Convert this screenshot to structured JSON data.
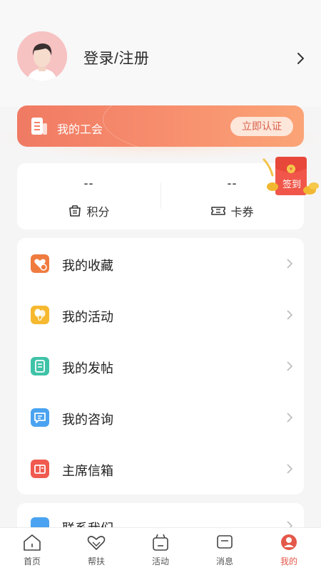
{
  "profile": {
    "login_label": "登录/注册"
  },
  "union": {
    "title": "我的工会",
    "verify_label": "立即认证"
  },
  "points": {
    "points_value": "--",
    "points_label": "积分",
    "coupons_value": "--",
    "coupons_label": "卡券"
  },
  "signin": {
    "label": "签到"
  },
  "menu": {
    "items": [
      {
        "label": "我的收藏",
        "icon": "heart-icon",
        "color": "#f07b3f"
      },
      {
        "label": "我的活动",
        "icon": "balloon-icon",
        "color": "#f5b82e"
      },
      {
        "label": "我的发帖",
        "icon": "document-icon",
        "color": "#3fc3a8"
      },
      {
        "label": "我的咨询",
        "icon": "chat-icon",
        "color": "#4aa3f0"
      },
      {
        "label": "主席信箱",
        "icon": "mailbox-icon",
        "color": "#f05a4f"
      }
    ],
    "partial_item": {
      "label": "联系我们",
      "icon": "phone-icon",
      "color": "#4aa3f0"
    }
  },
  "tabbar": {
    "tabs": [
      {
        "label": "首页",
        "icon": "home-icon"
      },
      {
        "label": "帮扶",
        "icon": "handshake-icon"
      },
      {
        "label": "活动",
        "icon": "activity-icon"
      },
      {
        "label": "消息",
        "icon": "message-icon"
      },
      {
        "label": "我的",
        "icon": "profile-icon",
        "active": true
      }
    ]
  },
  "colors": {
    "accent": "#f07a63",
    "active_tab": "#e4584a"
  }
}
